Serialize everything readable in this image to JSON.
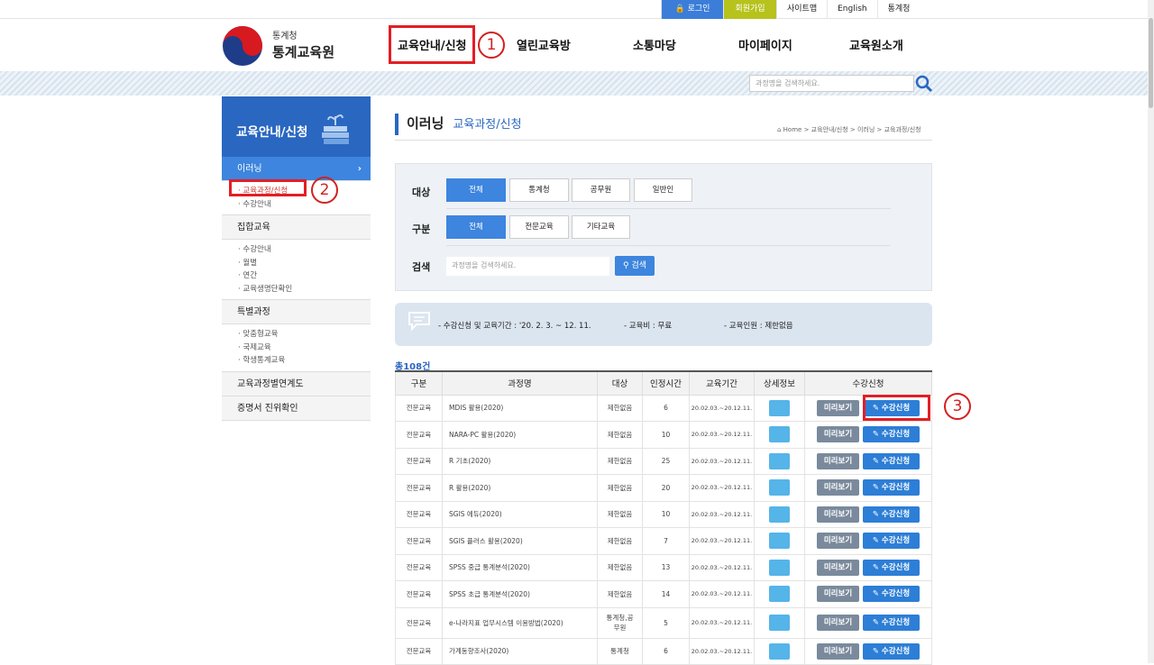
{
  "top_links": {
    "login": "로그인",
    "join": "회원가입",
    "sitemap": "사이트맵",
    "english": "English",
    "stat": "통계청"
  },
  "logo": {
    "line1": "통계청",
    "line2": "통계교육원"
  },
  "gnb": [
    "교육안내/신청",
    "열린교육방",
    "소통마당",
    "마이페이지",
    "교육원소개"
  ],
  "markers": {
    "one": "1",
    "two": "2",
    "three": "3"
  },
  "search_placeholder": "과정명을 검색하세요.",
  "side": {
    "title": "교육안내/신청",
    "items": [
      {
        "label": "이러닝"
      },
      {
        "label": "집합교육"
      },
      {
        "label": "특별과정"
      },
      {
        "label": "교육과정별연계도"
      },
      {
        "label": "증명서 진위확인"
      }
    ],
    "sub1": [
      "· 교육과정/신청",
      "· 수강안내"
    ],
    "sub2": [
      "· 수강안내",
      "· 월별",
      "· 연간",
      "· 교육생명단확인"
    ],
    "sub3": [
      "· 맞춤형교육",
      "· 국제교육",
      "· 학생통계교육"
    ],
    "arrow": "›"
  },
  "page": {
    "title": "이러닝",
    "subtitle": "교육과정/신청",
    "breadcrumb": "Home > 교육안내/신청 > 이러닝 > 교육과정/신청"
  },
  "filter": {
    "target_label": "대상",
    "targets": [
      "전체",
      "통계청",
      "공무원",
      "일반인"
    ],
    "type_label": "구분",
    "types": [
      "전체",
      "전문교육",
      "기타교육"
    ],
    "search_label": "검색",
    "search_placeholder": "과정명을 검색하세요.",
    "search_button": "검색"
  },
  "info": {
    "period": "- 수강신청 및 교육기간 : '20. 2. 3. ~ 12. 11.",
    "fee": "- 교육비 : 무료",
    "quota": "- 교육인원 : 제한없음"
  },
  "total": "총108건",
  "table": {
    "headers": [
      "구분",
      "과정명",
      "대상",
      "인정시간",
      "교육기간",
      "상세정보",
      "수강신청"
    ],
    "preview": "미리보기",
    "apply": "수강신청",
    "rows": [
      {
        "type": "전문교육",
        "name": "MDIS 활용(2020)",
        "target": "제한없음",
        "hours": "6",
        "period": "20.02.03.~20.12.11."
      },
      {
        "type": "전문교육",
        "name": "NARA-PC 활용(2020)",
        "target": "제한없음",
        "hours": "10",
        "period": "20.02.03.~20.12.11."
      },
      {
        "type": "전문교육",
        "name": "R 기초(2020)",
        "target": "제한없음",
        "hours": "25",
        "period": "20.02.03.~20.12.11."
      },
      {
        "type": "전문교육",
        "name": "R 활용(2020)",
        "target": "제한없음",
        "hours": "20",
        "period": "20.02.03.~20.12.11."
      },
      {
        "type": "전문교육",
        "name": "SGIS 에듀(2020)",
        "target": "제한없음",
        "hours": "10",
        "period": "20.02.03.~20.12.11."
      },
      {
        "type": "전문교육",
        "name": "SGIS 플러스 활용(2020)",
        "target": "제한없음",
        "hours": "7",
        "period": "20.02.03.~20.12.11."
      },
      {
        "type": "전문교육",
        "name": "SPSS 중급 통계분석(2020)",
        "target": "제한없음",
        "hours": "13",
        "period": "20.02.03.~20.12.11."
      },
      {
        "type": "전문교육",
        "name": "SPSS 초급 통계분석(2020)",
        "target": "제한없음",
        "hours": "14",
        "period": "20.02.03.~20.12.11."
      },
      {
        "type": "전문교육",
        "name": "e-나라지표 업무시스템 이용방법(2020)",
        "target": "통계청,공무원",
        "hours": "5",
        "period": "20.02.03.~20.12.11."
      },
      {
        "type": "전문교육",
        "name": "가계동향조사(2020)",
        "target": "통계청",
        "hours": "6",
        "period": "20.02.03.~20.12.11."
      }
    ]
  },
  "colors": {
    "primary": "#2a67c1",
    "accent": "#3d85de",
    "highlight": "#e31e24"
  }
}
